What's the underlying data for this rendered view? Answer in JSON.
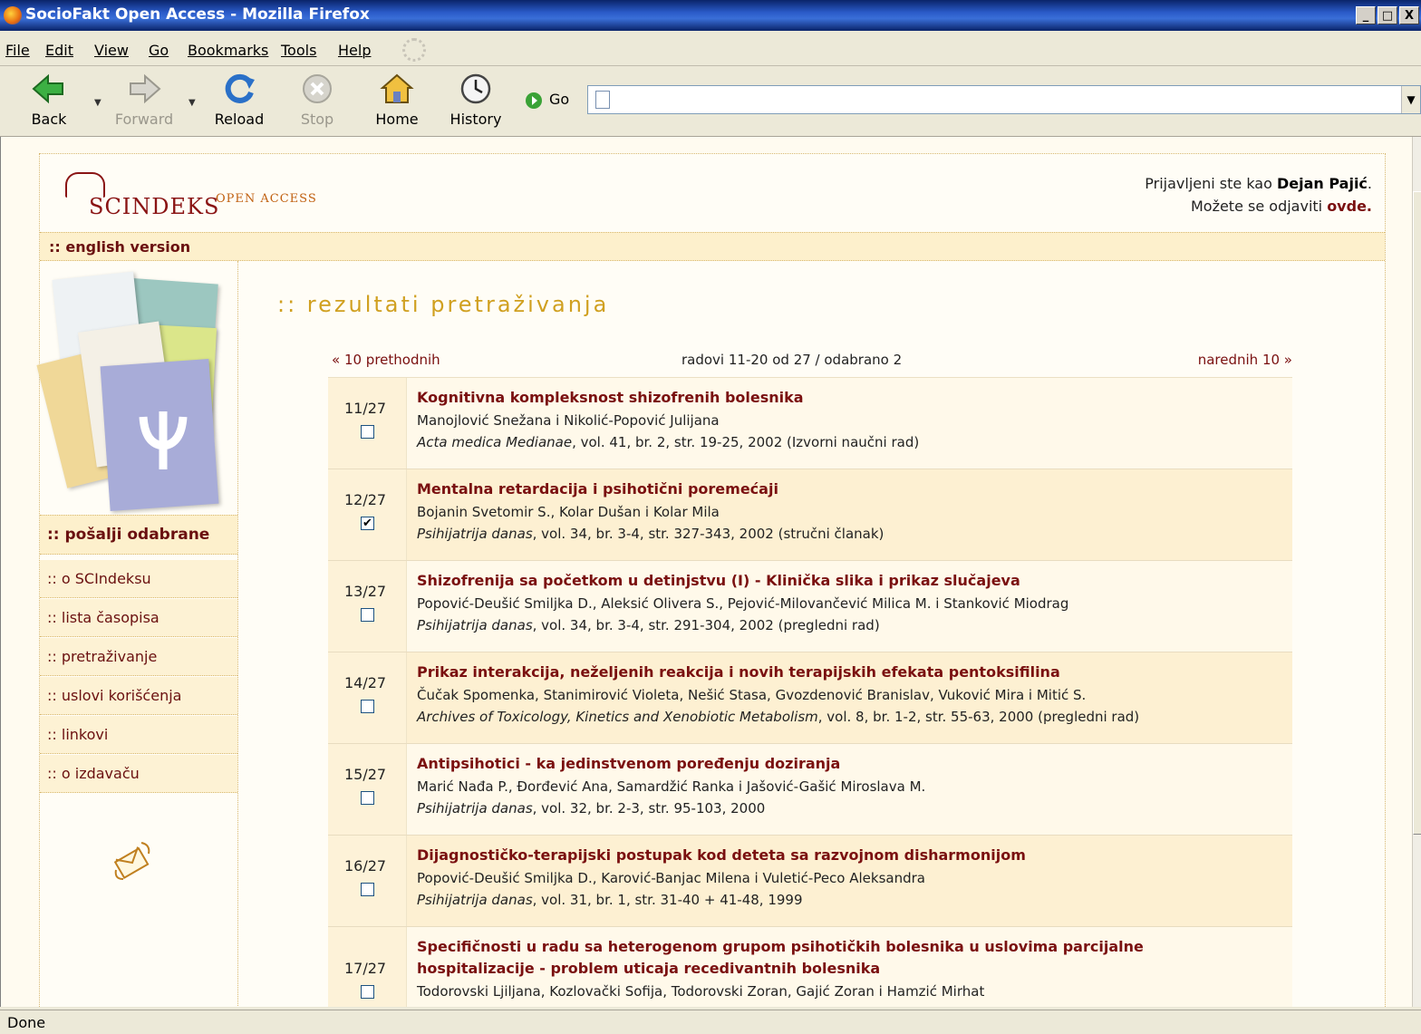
{
  "window": {
    "title": "SocioFakt Open Access - Mozilla Firefox",
    "min": "_",
    "max": "□",
    "close": "X"
  },
  "menubar": [
    "File",
    "Edit",
    "View",
    "Go",
    "Bookmarks",
    "Tools",
    "Help"
  ],
  "toolbar": {
    "back": "Back",
    "forward": "Forward",
    "reload": "Reload",
    "stop": "Stop",
    "home": "Home",
    "history": "History",
    "go": "Go",
    "url": ""
  },
  "status": "Done",
  "site": {
    "logo_word": "SCINDEKS",
    "logo_tag": "OPEN ACCESS",
    "login_line1_prefix": "Prijavljeni ste kao ",
    "login_user": "Dejan Pajić",
    "login_line1_suffix": ".",
    "login_line2_prefix": "Možete se odjaviti ",
    "login_logout": "ovde.",
    "english": ":: english version",
    "send": ":: pošalji odabrane",
    "menu": [
      ":: o SCIndeksu",
      ":: lista časopisa",
      ":: pretraživanje",
      ":: uslovi korišćenja",
      ":: linkovi",
      ":: o izdavaču"
    ]
  },
  "results": {
    "title": ":: rezultati pretraživanja",
    "prev": "« 10 prethodnih",
    "summary": "radovi 11-20 od 27 / odabrano 2",
    "next": "narednih 10 »",
    "items": [
      {
        "num": "11/27",
        "checked": false,
        "title": "Kognitivna kompleksnost shizofrenih bolesnika",
        "authors": "Manojlović Snežana i Nikolić-Popović Julijana",
        "journal": "Acta medica Medianae",
        "details": ", vol. 41, br. 2, str. 19-25, 2002 (Izvorni naučni rad)"
      },
      {
        "num": "12/27",
        "checked": true,
        "title": "Mentalna retardacija i psihotični poremećaji",
        "authors": "Bojanin Svetomir S., Kolar Dušan i Kolar Mila",
        "journal": "Psihijatrija danas",
        "details": ", vol. 34, br. 3-4, str. 327-343, 2002 (stručni članak)"
      },
      {
        "num": "13/27",
        "checked": false,
        "title": "Shizofrenija sa početkom u detinjstvu (I) - Klinička slika i prikaz slučajeva",
        "authors": "Popović-Deušić Smiljka D., Aleksić Olivera S., Pejović-Milovančević Milica M. i Stanković Miodrag",
        "journal": "Psihijatrija danas",
        "details": ", vol. 34, br. 3-4, str. 291-304, 2002 (pregledni rad)"
      },
      {
        "num": "14/27",
        "checked": false,
        "title": "Prikaz interakcija, neželjenih reakcija i novih terapijskih efekata pentoksifilina",
        "authors": "Čučak Spomenka, Stanimirović Violeta, Nešić Stasa, Gvozdenović Branislav, Vuković Mira i Mitić S.",
        "journal": "Archives of Toxicology, Kinetics and Xenobiotic Metabolism",
        "details": ", vol. 8, br. 1-2, str. 55-63, 2000 (pregledni rad)"
      },
      {
        "num": "15/27",
        "checked": false,
        "title": "Antipsihotici - ka jedinstvenom poređenju doziranja",
        "authors": "Marić Nađa P., Đorđević Ana, Samardžić Ranka i Jašović-Gašić Miroslava M.",
        "journal": "Psihijatrija danas",
        "details": ", vol. 32, br. 2-3, str. 95-103, 2000"
      },
      {
        "num": "16/27",
        "checked": false,
        "title": "Dijagnostičko-terapijski postupak kod deteta sa razvojnom disharmonijom",
        "authors": "Popović-Deušić Smiljka D., Karović-Banjac Milena i Vuletić-Peco Aleksandra",
        "journal": "Psihijatrija danas",
        "details": ", vol. 31, br. 1, str. 31-40 + 41-48, 1999"
      },
      {
        "num": "17/27",
        "checked": false,
        "title": "Specifičnosti u radu sa heterogenom grupom psihotičkih bolesnika u uslovima parcijalne",
        "title2": "hospitalizacije - problem uticaja recedivantnih bolesnika",
        "authors": "Todorovski Ljiljana, Kozlovački Sofija, Todorovski Zoran, Gajić Zoran i Hamzić Mirhat",
        "journal": "",
        "details": ""
      }
    ]
  }
}
